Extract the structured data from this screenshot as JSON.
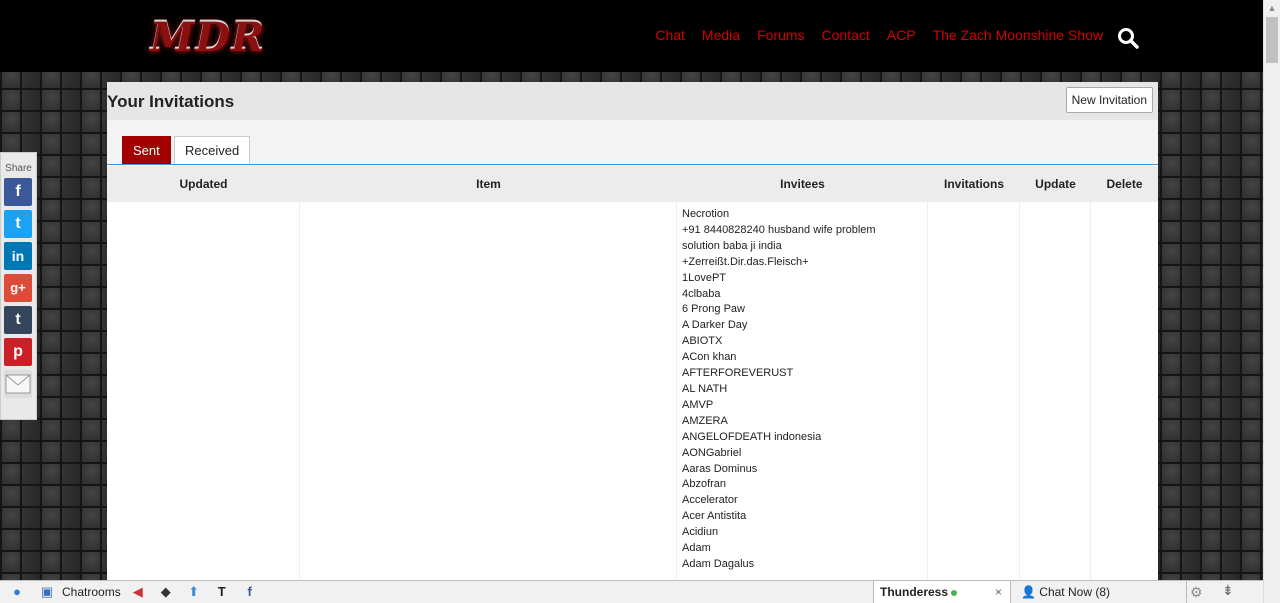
{
  "site": {
    "logo_text": "MDR",
    "nav": [
      "Chat",
      "Media",
      "Forums",
      "Contact",
      "ACP",
      "The Zach Moonshine Show"
    ]
  },
  "page": {
    "title": "Your Invitations",
    "new_invitation_label": "New Invitation"
  },
  "tabs": {
    "sent": "Sent",
    "received": "Received"
  },
  "table": {
    "headers": {
      "updated": "Updated",
      "item": "Item",
      "invitees": "Invitees",
      "invitations": "Invitations",
      "update": "Update",
      "delete": "Delete"
    },
    "invitees": [
      "Necrotion",
      "+91 8440828240 husband wife problem",
      "solution baba ji india",
      "+Zerreißt.Dir.das.Fleisch+",
      "1LovePT",
      "4clbaba",
      "6 Prong Paw",
      "A Darker Day",
      "ABIOTX",
      "ACon khan",
      "AFTERFOREVERUST",
      "AL NATH",
      "AMVP",
      "AMZERA",
      "ANGELOFDEATH indonesia",
      "AONGabriel",
      "Aaras Dominus",
      "Abzofran",
      "Accelerator",
      "Acer Antistita",
      "Acidiun",
      "Adam",
      "Adam Dagalus"
    ]
  },
  "share": {
    "label": "Share"
  },
  "bottombar": {
    "chatrooms_label": "Chatrooms",
    "user_name": "Thunderess",
    "close_symbol": "×",
    "chat_now_label": "Chat Now (8)"
  },
  "colors": {
    "accent": "#a30000",
    "nav": "#d40000"
  }
}
